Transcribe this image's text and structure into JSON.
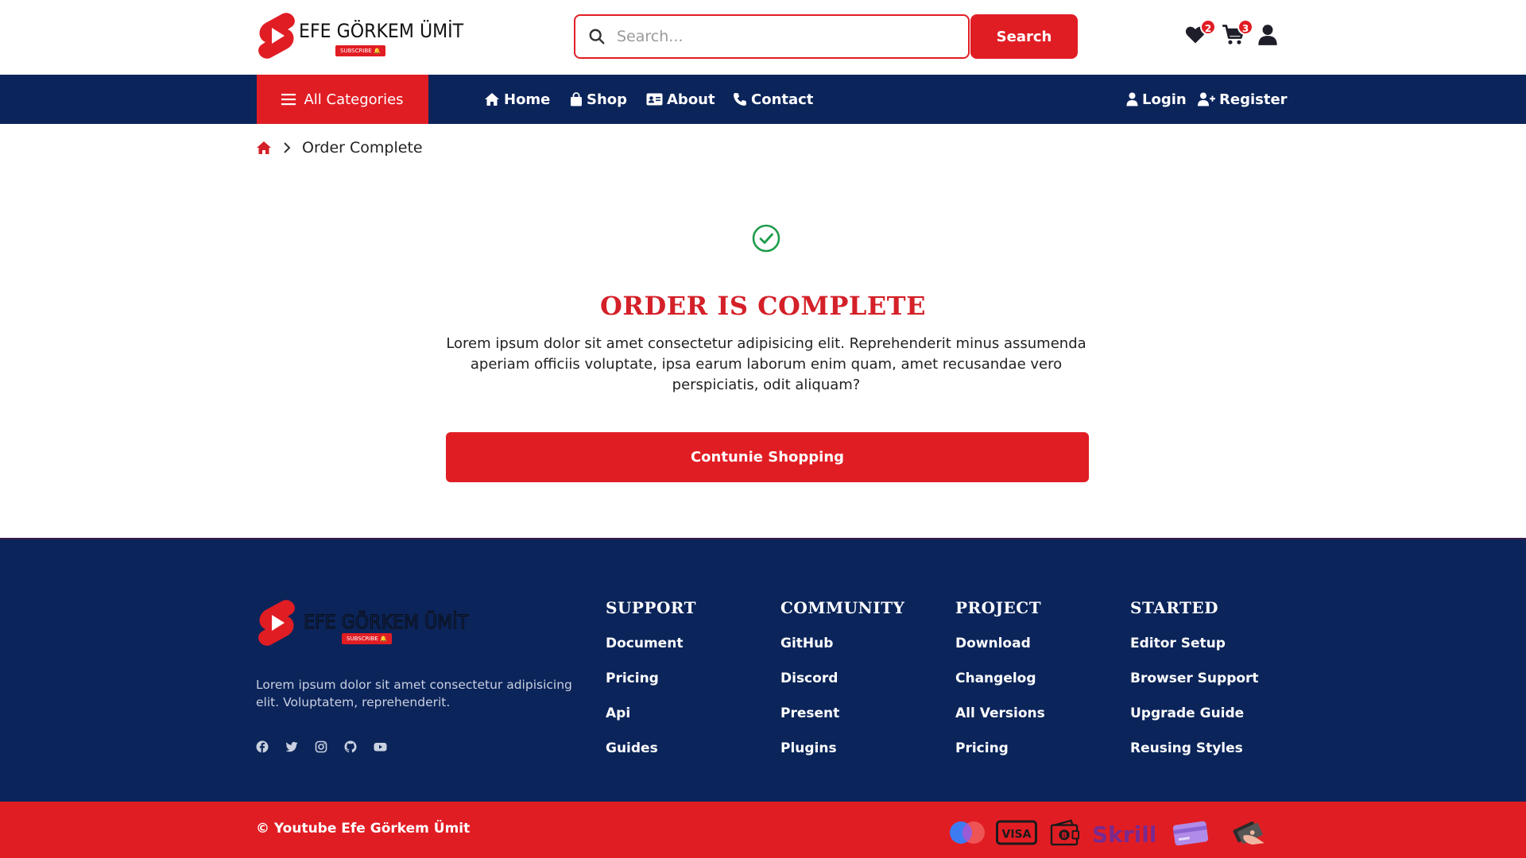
{
  "brand": {
    "name": "EFE GÖRKEM ÜMİT",
    "subscribe": "SUBSCRIBE"
  },
  "header": {
    "search_placeholder": "Search...",
    "search_button": "Search",
    "wishlist_count": "2",
    "cart_count": "3"
  },
  "nav": {
    "all_categories": "All Categories",
    "links": [
      "Home",
      "Shop",
      "About",
      "Contact"
    ],
    "login": "Login",
    "register": "Register"
  },
  "breadcrumb": {
    "current": "Order Complete"
  },
  "main": {
    "title": "ORDER IS COMPLETE",
    "description": "Lorem ipsum dolor sit amet consectetur adipisicing elit. Reprehenderit minus assumenda aperiam officiis voluptate, ipsa earum laborum enim quam, amet recusandae vero perspiciatis, odit aliquam?",
    "button": "Contunie Shopping"
  },
  "footer": {
    "description": "Lorem ipsum dolor sit amet consectetur adipisicing elit. Voluptatem, reprehenderit.",
    "socials": [
      "facebook-icon",
      "twitter-icon",
      "instagram-icon",
      "github-icon",
      "youtube-icon"
    ],
    "columns": [
      {
        "title": "SUPPORT",
        "links": [
          "Document",
          "Pricing",
          "Api",
          "Guides"
        ]
      },
      {
        "title": "COMMUNITY",
        "links": [
          "GitHub",
          "Discord",
          "Present",
          "Plugins"
        ]
      },
      {
        "title": "PROJECT",
        "links": [
          "Download",
          "Changelog",
          "All Versions",
          "Pricing"
        ]
      },
      {
        "title": "STARTED",
        "links": [
          "Editor Setup",
          "Browser Support",
          "Upgrade Guide",
          "Reusing Styles"
        ]
      }
    ],
    "copyright": "© Youtube Efe Görkem Ümit",
    "payments": [
      "maestro-icon",
      "visa-icon",
      "wallet-icon",
      "skrill-icon",
      "card-icon",
      "cash-icon"
    ],
    "skrill_text": "Skrill",
    "visa_text": "VISA"
  },
  "colors": {
    "primary_red": "#e11d24",
    "navy": "#0b245a",
    "success_green": "#1f9d4c"
  }
}
